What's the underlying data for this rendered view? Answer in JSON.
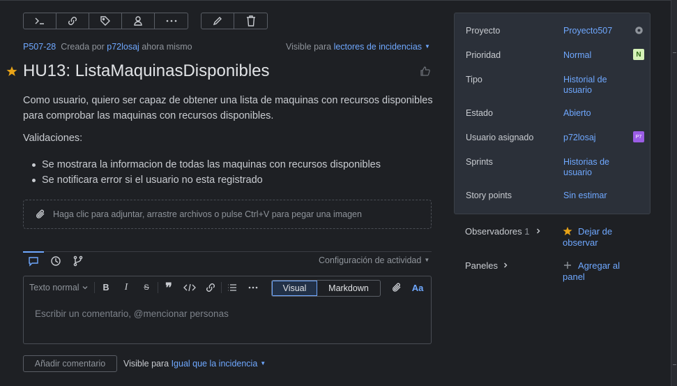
{
  "toolbar": {
    "group1": [
      "terminal-icon",
      "link-icon",
      "tag-icon",
      "user-icon",
      "more-icon"
    ],
    "group2": [
      "edit-icon",
      "trash-icon"
    ]
  },
  "issue": {
    "key": "P507-28",
    "created_by_prefix": "Creada por",
    "author": "p72losaj",
    "created_time": "ahora mismo",
    "visible_prefix": "Visible para",
    "visible_target": "lectores de incidencias",
    "title": "HU13: ListaMaquinasDisponibles",
    "description": "Como usuario, quiero ser capaz de obtener una lista de maquinas con recursos disponibles para comprobar las maquinas con recursos disponibles.",
    "validations_heading": "Validaciones:",
    "validations": [
      "Se mostrara la informacion de todas las maquinas con recursos disponibles",
      "Se notificara error si el usuario no esta registrado"
    ]
  },
  "attach": {
    "text": "Haga clic para adjuntar, arrastre archivos o pulse Ctrl+V para pegar una imagen"
  },
  "activity": {
    "config_label": "Configuración de actividad",
    "tabs": [
      "comment-icon",
      "history-icon",
      "branch-icon"
    ]
  },
  "editor": {
    "text_style": "Texto normal",
    "mode_visual": "Visual",
    "mode_markdown": "Markdown",
    "placeholder": "Escribir un comentario, @mencionar personas",
    "format_label": "Aa"
  },
  "comment": {
    "add_label": "Añadir comentario",
    "visible_prefix": "Visible para",
    "visible_target": "Igual que la incidencia"
  },
  "panel": {
    "rows": [
      {
        "label": "Proyecto",
        "value": "Proyecto507"
      },
      {
        "label": "Prioridad",
        "value": "Normal",
        "badge": "N"
      },
      {
        "label": "Tipo",
        "value": "Historial de usuario"
      },
      {
        "label": "Estado",
        "value": "Abierto"
      },
      {
        "label": "Usuario asignado",
        "value": "p72losaj",
        "badge": "P7"
      },
      {
        "label": "Sprints",
        "value": "Historias de usuario"
      },
      {
        "label": "Story points",
        "value": "Sin estimar"
      }
    ]
  },
  "sidebar": {
    "watchers_label": "Observadores",
    "watchers_count": "1",
    "stop_watching": "Dejar de observar",
    "boards_label": "Paneles",
    "add_board": "Agregar al panel"
  },
  "colors": {
    "accent": "#6fa8ff",
    "background": "#1e2024",
    "panel": "#2b3039",
    "star": "#e8a317"
  }
}
